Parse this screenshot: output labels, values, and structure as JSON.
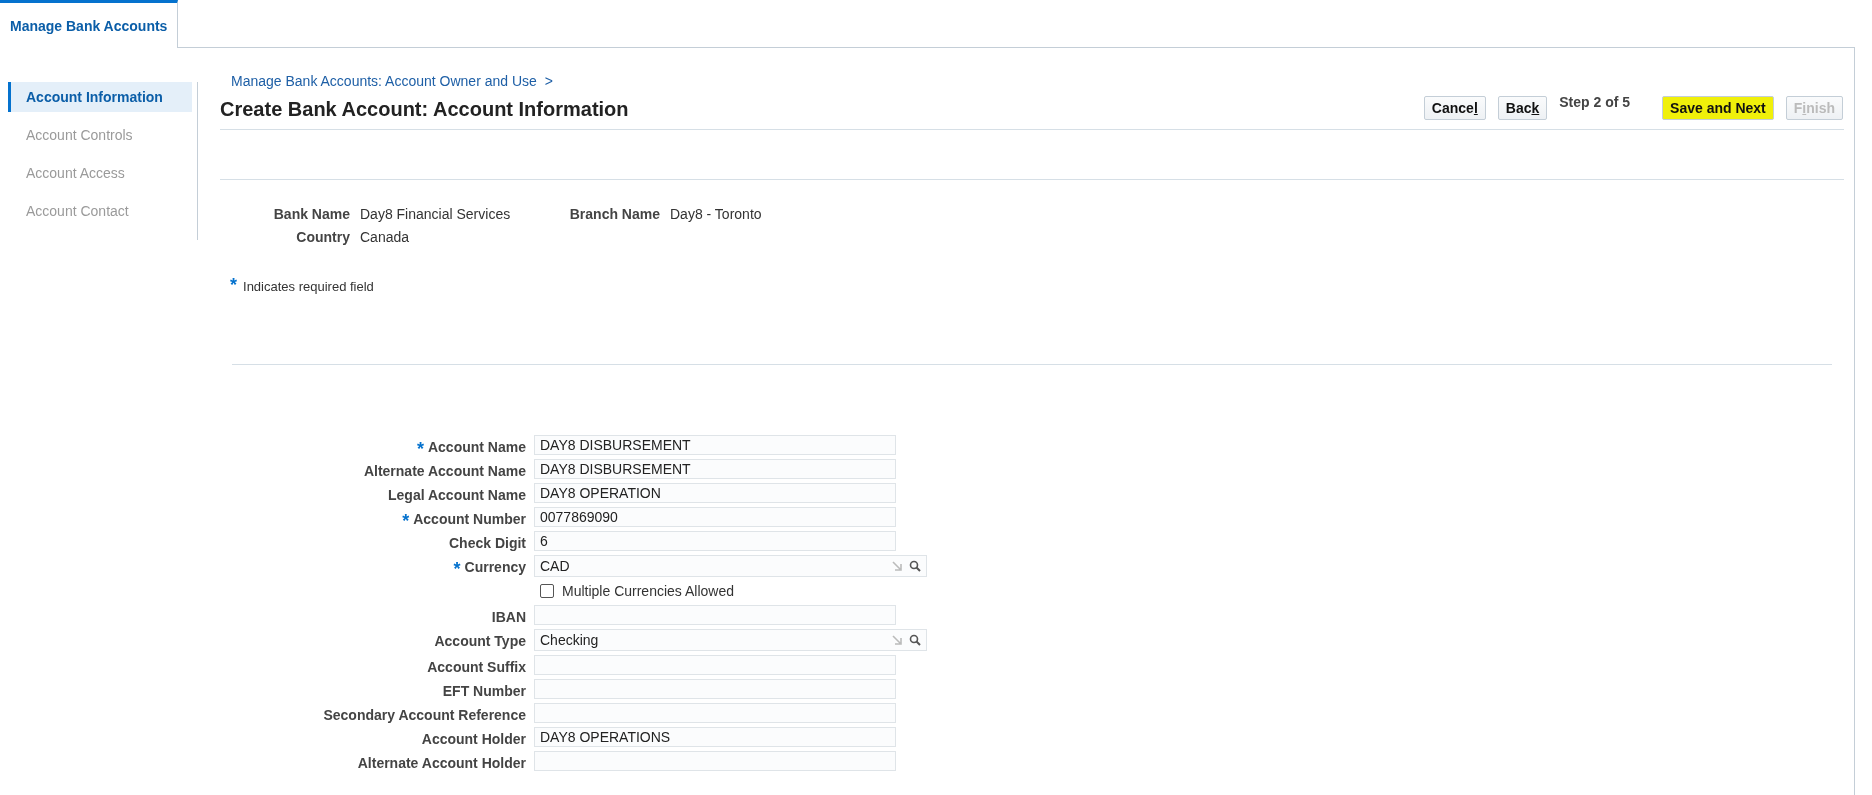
{
  "tabs": [
    {
      "label": "Manage Bank Accounts",
      "selected": true
    }
  ],
  "sidebar": {
    "items": [
      {
        "label": "Account Information",
        "selected": true,
        "disabled": false
      },
      {
        "label": "Account Controls",
        "selected": false,
        "disabled": true
      },
      {
        "label": "Account Access",
        "selected": false,
        "disabled": true
      },
      {
        "label": "Account Contact",
        "selected": false,
        "disabled": true
      }
    ]
  },
  "breadcrumb": {
    "label": "Manage Bank Accounts: Account Owner and Use",
    "separator": ">"
  },
  "title": "Create Bank Account: Account Information",
  "train": {
    "step": "Step 2 of 5",
    "buttons": [
      {
        "parts": [
          {
            "text": "Cance",
            "underlined": false
          },
          {
            "text": "l",
            "underlined": true
          }
        ],
        "disabled": false,
        "highlighted": false
      },
      {
        "parts": [
          {
            "text": "Bac",
            "underlined": false
          },
          {
            "text": "k",
            "underlined": true
          }
        ],
        "disabled": false,
        "highlighted": false
      },
      {
        "parts": [
          {
            "text": "Save and Next",
            "underlined": false
          }
        ],
        "disabled": false,
        "highlighted": true
      },
      {
        "parts": [
          {
            "text": "F",
            "underlined": false
          },
          {
            "text": "i",
            "underlined": true
          },
          {
            "text": "nish",
            "underlined": false
          }
        ],
        "disabled": true,
        "highlighted": false
      }
    ]
  },
  "bank_info": [
    {
      "label": "Bank Name",
      "value": "Day8 Financial Services"
    },
    {
      "label": "Branch Name",
      "value": "Day8 - Toronto"
    },
    {
      "label": "Country",
      "value": "Canada"
    }
  ],
  "required_note": {
    "mark": "*",
    "text": "Indicates required field"
  },
  "form": [
    {
      "kind": "text",
      "label": "Account Name",
      "required": true,
      "value": "DAY8 DISBURSEMENT"
    },
    {
      "kind": "text",
      "label": "Alternate Account Name",
      "required": false,
      "value": "DAY8 DISBURSEMENT"
    },
    {
      "kind": "text",
      "label": "Legal Account Name",
      "required": false,
      "value": "DAY8 OPERATION"
    },
    {
      "kind": "text",
      "label": "Account Number",
      "required": true,
      "value": "0077869090"
    },
    {
      "kind": "text",
      "label": "Check Digit",
      "required": false,
      "value": "6"
    },
    {
      "kind": "lov",
      "label": "Currency",
      "required": true,
      "value": "CAD"
    },
    {
      "kind": "checkbox",
      "label": "Multiple Currencies Allowed",
      "checked": false
    },
    {
      "kind": "text",
      "label": "IBAN",
      "required": false
    },
    {
      "kind": "lov",
      "label": "Account Type",
      "required": false,
      "value": "Checking"
    },
    {
      "kind": "text",
      "label": "Account Suffix",
      "required": false
    },
    {
      "kind": "text",
      "label": "EFT Number",
      "required": false
    },
    {
      "kind": "text",
      "label": "Secondary Account Reference",
      "required": false
    },
    {
      "kind": "text",
      "label": "Account Holder",
      "required": false,
      "value": "DAY8 OPERATIONS"
    },
    {
      "kind": "text",
      "label": "Alternate Account Holder",
      "required": false
    }
  ]
}
